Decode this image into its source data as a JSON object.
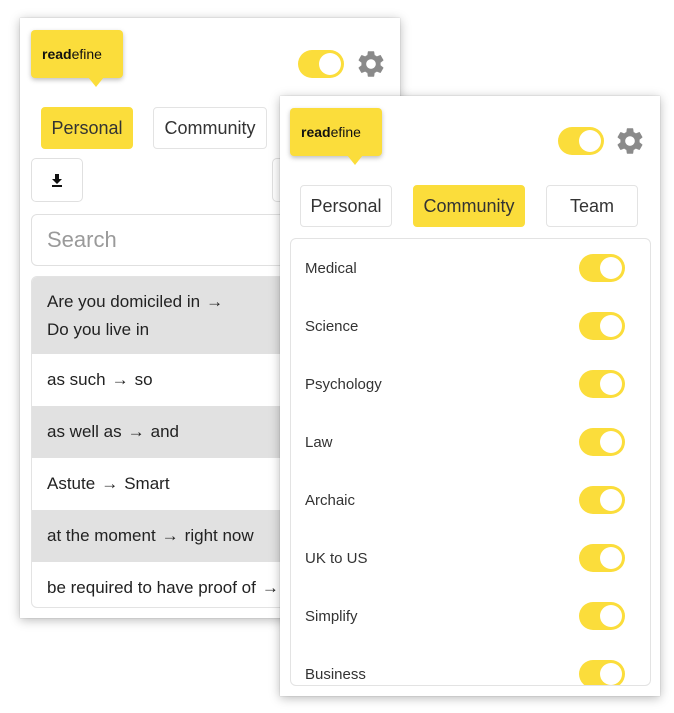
{
  "brand": {
    "bold": "read",
    "rest": "efine"
  },
  "back_panel": {
    "tabs": [
      {
        "label": "Personal",
        "active": true
      },
      {
        "label": "Community",
        "active": false
      }
    ],
    "search": {
      "placeholder": "Search"
    },
    "entries": [
      {
        "from": "Are you domiciled in",
        "arrow": "→",
        "to": "Do you live in"
      },
      {
        "from": "as such",
        "arrow": "→",
        "to": "so"
      },
      {
        "from": "as well as",
        "arrow": "→",
        "to": "and"
      },
      {
        "from": "Astute",
        "arrow": "→",
        "to": "Smart"
      },
      {
        "from": "at the moment",
        "arrow": "→",
        "to": "right now"
      },
      {
        "from": "be required to have proof of",
        "arrow": "→",
        "to": ""
      }
    ]
  },
  "front_panel": {
    "tabs": [
      {
        "label": "Personal",
        "active": false
      },
      {
        "label": "Community",
        "active": true
      },
      {
        "label": "Team",
        "active": false
      }
    ],
    "categories": [
      {
        "label": "Medical",
        "enabled": true
      },
      {
        "label": "Science",
        "enabled": true
      },
      {
        "label": "Psychology",
        "enabled": true
      },
      {
        "label": "Law",
        "enabled": true
      },
      {
        "label": "Archaic",
        "enabled": true
      },
      {
        "label": "UK to US",
        "enabled": true
      },
      {
        "label": "Simplify",
        "enabled": true
      },
      {
        "label": "Business",
        "enabled": true
      }
    ]
  },
  "icons": {
    "settings": "gear-icon",
    "download": "download-icon"
  },
  "colors": {
    "accent": "#fbdd3b",
    "row_shade": "#e1e1e1",
    "gear": "#8a8a8a"
  }
}
